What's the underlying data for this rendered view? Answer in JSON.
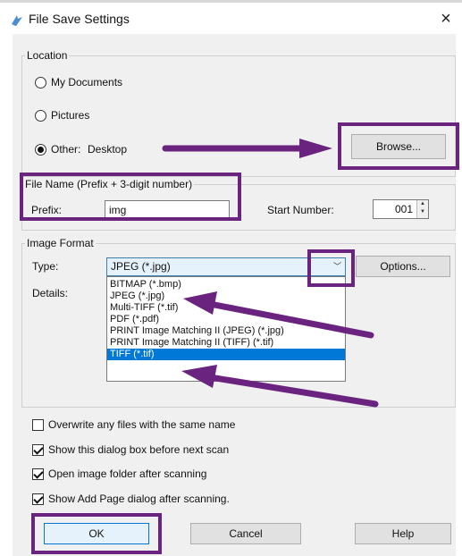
{
  "window": {
    "title": "File Save Settings",
    "close_glyph": "×"
  },
  "location": {
    "legend": "Location",
    "options": [
      "My Documents",
      "Pictures",
      "Other:"
    ],
    "selected": "Other:",
    "other_path": "Desktop",
    "browse_label": "Browse..."
  },
  "file_name": {
    "legend": "File Name (Prefix + 3-digit number)",
    "prefix_label": "Prefix:",
    "prefix_value": "img",
    "start_label": "Start Number:",
    "start_value": "001"
  },
  "image_format": {
    "legend": "Image Format",
    "type_label": "Type:",
    "type_value": "JPEG (*.jpg)",
    "options_label": "Options...",
    "details_label": "Details:",
    "dropdown_items": [
      "BITMAP (*.bmp)",
      "JPEG (*.jpg)",
      "Multi-TIFF (*.tif)",
      "PDF (*.pdf)",
      "PRINT Image Matching II (JPEG) (*.jpg)",
      "PRINT Image Matching II (TIFF) (*.tif)",
      "TIFF (*.tif)"
    ],
    "highlighted_item": "TIFF (*.tif)"
  },
  "checkboxes": [
    {
      "label": "Overwrite any files with the same name",
      "checked": false
    },
    {
      "label": "Show this dialog box before next scan",
      "checked": true
    },
    {
      "label": "Open image folder after scanning",
      "checked": true
    },
    {
      "label": "Show Add Page dialog after scanning.",
      "checked": true
    }
  ],
  "buttons": {
    "ok": "OK",
    "cancel": "Cancel",
    "help": "Help"
  },
  "annotation_color": "#6b2380",
  "icons": {
    "app": "scanner-app-icon",
    "close": "close-icon",
    "dropdown": "chevron-down-icon",
    "spinner": "spinner-arrows-icon"
  }
}
